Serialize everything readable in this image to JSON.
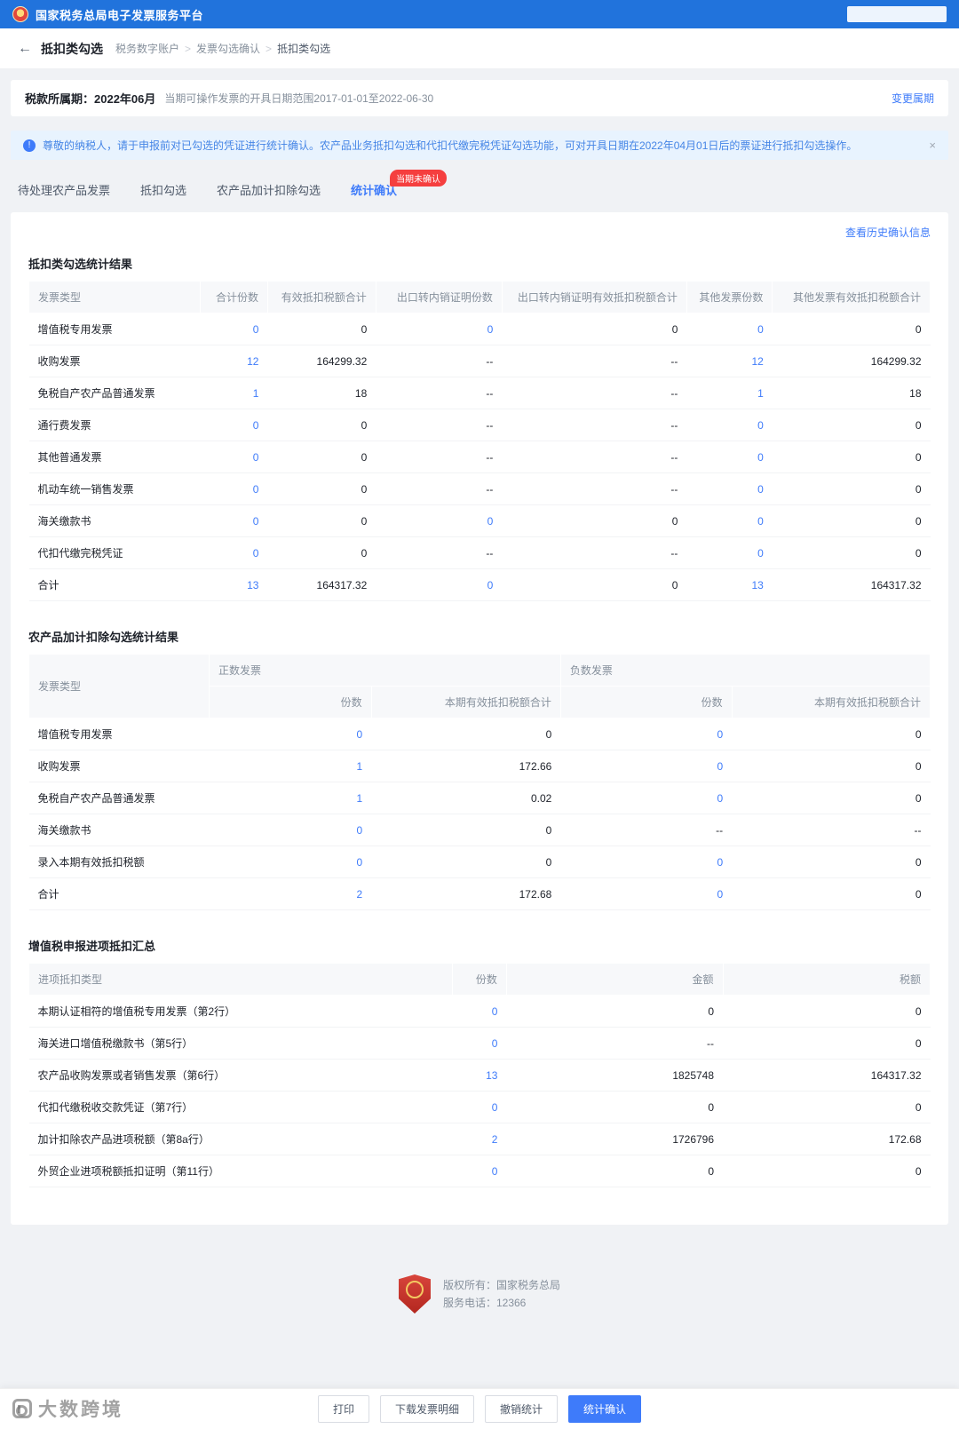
{
  "colors": {
    "header_blue": "#2173dc",
    "accent_blue": "#3e7bfa",
    "badge_red": "#f53f3f",
    "notice_bg": "#e8f3fe"
  },
  "header": {
    "title": "国家税务总局电子发票服务平台"
  },
  "nav": {
    "back": "←",
    "page_title": "抵扣类勾选",
    "breadcrumb": [
      "税务数字账户",
      "发票勾选确认",
      "抵扣类勾选"
    ]
  },
  "period": {
    "label": "税款所属期：",
    "value": "2022年06月",
    "hint": "当期可操作发票的开具日期范围2017-01-01至2022-06-30",
    "change_link": "变更属期"
  },
  "notice": {
    "icon": "!",
    "text": "尊敬的纳税人，请于申报前对已勾选的凭证进行统计确认。农产品业务抵扣勾选和代扣代缴完税凭证勾选功能，可对开具日期在2022年04月01日后的票证进行抵扣勾选操作。",
    "close": "×"
  },
  "tabs": [
    {
      "label": "待处理农产品发票",
      "active": false
    },
    {
      "label": "抵扣勾选",
      "active": false
    },
    {
      "label": "农产品加计扣除勾选",
      "active": false
    },
    {
      "label": "统计确认",
      "active": true,
      "badge": "当期未确认"
    }
  ],
  "history_link": "查看历史确认信息",
  "section1": {
    "title": "抵扣类勾选统计结果",
    "columns": [
      "发票类型",
      "合计份数",
      "有效抵扣税额合计",
      "出口转内销证明份数",
      "出口转内销证明有效抵扣税额合计",
      "其他发票份数",
      "其他发票有效抵扣税额合计"
    ],
    "rows": [
      [
        "增值税专用发票",
        "0",
        "0",
        "0",
        "0",
        "0",
        "0"
      ],
      [
        "收购发票",
        "12",
        "164299.32",
        "--",
        "--",
        "12",
        "164299.32"
      ],
      [
        "免税自产农产品普通发票",
        "1",
        "18",
        "--",
        "--",
        "1",
        "18"
      ],
      [
        "通行费发票",
        "0",
        "0",
        "--",
        "--",
        "0",
        "0"
      ],
      [
        "其他普通发票",
        "0",
        "0",
        "--",
        "--",
        "0",
        "0"
      ],
      [
        "机动车统一销售发票",
        "0",
        "0",
        "--",
        "--",
        "0",
        "0"
      ],
      [
        "海关缴款书",
        "0",
        "0",
        "0",
        "0",
        "0",
        "0"
      ],
      [
        "代扣代缴完税凭证",
        "0",
        "0",
        "--",
        "--",
        "0",
        "0"
      ],
      [
        "合计",
        "13",
        "164317.32",
        "0",
        "0",
        "13",
        "164317.32"
      ]
    ]
  },
  "section2": {
    "title": "农产品加计扣除勾选统计结果",
    "header": {
      "type": "发票类型",
      "positive": "正数发票",
      "negative": "负数发票",
      "count": "份数",
      "amount": "本期有效抵扣税额合计"
    },
    "rows": [
      [
        "增值税专用发票",
        "0",
        "0",
        "0",
        "0"
      ],
      [
        "收购发票",
        "1",
        "172.66",
        "0",
        "0"
      ],
      [
        "免税自产农产品普通发票",
        "1",
        "0.02",
        "0",
        "0"
      ],
      [
        "海关缴款书",
        "0",
        "0",
        "--",
        "--"
      ],
      [
        "录入本期有效抵扣税额",
        "0",
        "0",
        "0",
        "0"
      ],
      [
        "合计",
        "2",
        "172.68",
        "0",
        "0"
      ]
    ]
  },
  "section3": {
    "title": "增值税申报进项抵扣汇总",
    "columns": [
      "进项抵扣类型",
      "份数",
      "金额",
      "税额"
    ],
    "rows": [
      [
        "本期认证相符的增值税专用发票（第2行）",
        "0",
        "0",
        "0"
      ],
      [
        "海关进口增值税缴款书（第5行）",
        "0",
        "--",
        "0"
      ],
      [
        "农产品收购发票或者销售发票（第6行）",
        "13",
        "1825748",
        "164317.32"
      ],
      [
        "代扣代缴税收交款凭证（第7行）",
        "0",
        "0",
        "0"
      ],
      [
        "加计扣除农产品进项税额（第8a行）",
        "2",
        "1726796",
        "172.68"
      ],
      [
        "外贸企业进项税额抵扣证明（第11行）",
        "0",
        "0",
        "0"
      ]
    ]
  },
  "footer": {
    "line1": "版权所有：国家税务总局",
    "line2": "服务电话：12366"
  },
  "actions": [
    {
      "label": "打印",
      "primary": false
    },
    {
      "label": "下载发票明细",
      "primary": false
    },
    {
      "label": "撤销统计",
      "primary": false
    },
    {
      "label": "统计确认",
      "primary": true
    }
  ],
  "watermark": "大数跨境"
}
